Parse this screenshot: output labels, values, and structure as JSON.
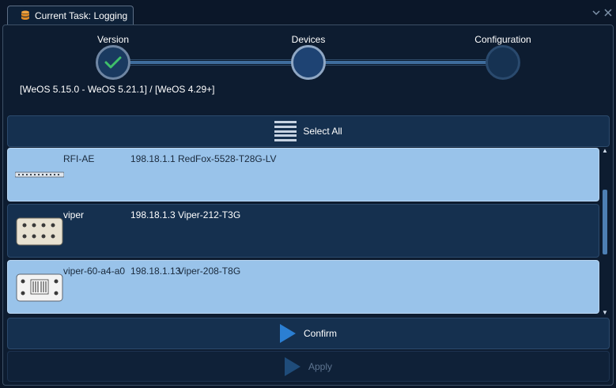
{
  "tab": {
    "title": "Current Task: Logging",
    "icon": "database-icon"
  },
  "window_controls": {
    "collapse_icon": "chevron-down-icon",
    "close_icon": "close-icon"
  },
  "steps": [
    {
      "label": "Version",
      "state": "completed"
    },
    {
      "label": "Devices",
      "state": "current"
    },
    {
      "label": "Configuration",
      "state": "pending"
    }
  ],
  "version_range": "[WeOS 5.15.0 - WeOS 5.21.1] / [WeOS 4.29+]",
  "select_all": {
    "label": "Select All",
    "icon": "list-icon"
  },
  "devices": [
    {
      "name": "RFI-AE",
      "ip": "198.18.1.1",
      "model": "RedFox-5528-T28G-LV",
      "selected": true,
      "icon": "rackmount-switch-icon"
    },
    {
      "name": "viper",
      "ip": "198.18.1.3",
      "model": "Viper-212-T3G",
      "selected": false,
      "icon": "rugged-switch-icon"
    },
    {
      "name": "viper-60-a4-a0",
      "ip": "198.18.1.13",
      "model": "Viper-208-T8G",
      "selected": true,
      "icon": "rugged-switch-icon"
    }
  ],
  "confirm": {
    "label": "Confirm",
    "icon": "play-icon"
  },
  "apply": {
    "label": "Apply",
    "icon": "play-icon",
    "enabled": false
  },
  "colors": {
    "accent": "#2b7fd3",
    "selected_row": "#99c3ea",
    "unselected_row": "#15304f",
    "check": "#3fbf6a"
  }
}
